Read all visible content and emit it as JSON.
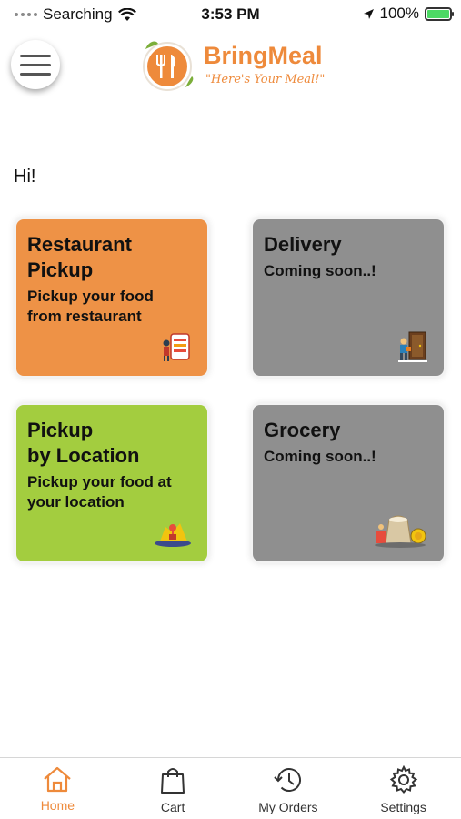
{
  "status_bar": {
    "carrier": "Searching",
    "time": "3:53 PM",
    "battery": "100%"
  },
  "header": {
    "brand_name": "BringMeal",
    "tagline": "\"Here's Your Meal!\""
  },
  "greeting": "Hi!",
  "cards": {
    "restaurant_pickup": {
      "title": "Restaurant\nPickup",
      "subtitle": "Pickup your food\nfrom restaurant",
      "color": "#ee9246"
    },
    "delivery": {
      "title": "Delivery",
      "subtitle": "Coming soon..!",
      "color": "#8f8f8f"
    },
    "pickup_by_location": {
      "title": "Pickup\nby Location",
      "subtitle": "Pickup your food at\nyour location",
      "color": "#a3cd3f"
    },
    "grocery": {
      "title": "Grocery",
      "subtitle": "Coming soon..!",
      "color": "#8f8f8f"
    }
  },
  "tabs": [
    {
      "label": "Home",
      "icon": "home-icon",
      "active": true
    },
    {
      "label": "Cart",
      "icon": "bag-icon",
      "active": false
    },
    {
      "label": "My Orders",
      "icon": "history-icon",
      "active": false
    },
    {
      "label": "Settings",
      "icon": "gear-icon",
      "active": false
    }
  ],
  "colors": {
    "accent": "#ee8a3b"
  }
}
